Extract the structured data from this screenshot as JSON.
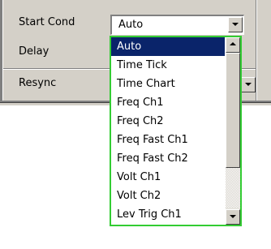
{
  "fields": {
    "start_cond": {
      "label": "Start Cond",
      "value": "Auto"
    },
    "delay": {
      "label": "Delay"
    },
    "resync": {
      "label": "Resync"
    }
  },
  "dropdown": {
    "options": [
      "Auto",
      "Time Tick",
      "Time Chart",
      "Freq Ch1",
      "Freq Ch2",
      "Freq Fast Ch1",
      "Freq Fast Ch2",
      "Volt Ch1",
      "Volt Ch2",
      "Lev Trig Ch1"
    ],
    "selected_index": 0
  },
  "colors": {
    "panel": "#d4d0c8",
    "selection": "#0a246a",
    "dropdown_border": "#33cc33"
  }
}
